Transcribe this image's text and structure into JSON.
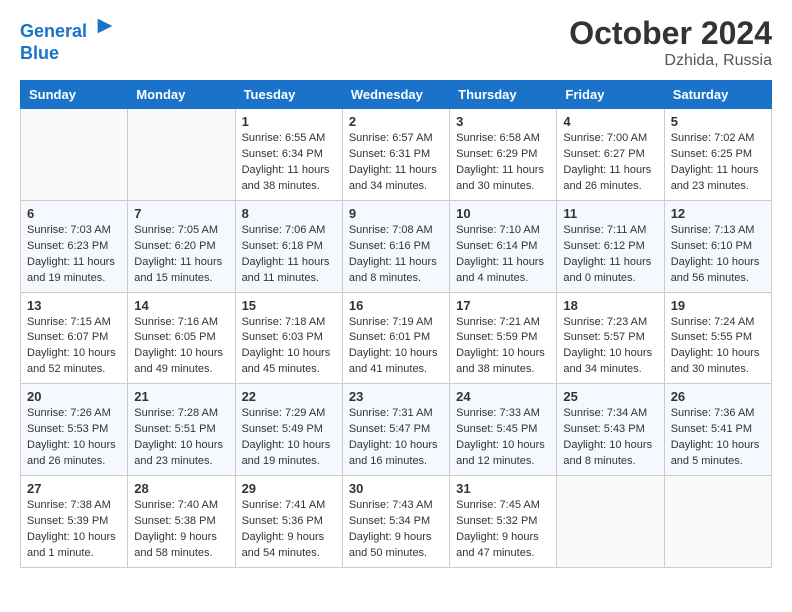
{
  "header": {
    "logo_line1": "General",
    "logo_line2": "Blue",
    "month_year": "October 2024",
    "location": "Dzhida, Russia"
  },
  "days_of_week": [
    "Sunday",
    "Monday",
    "Tuesday",
    "Wednesday",
    "Thursday",
    "Friday",
    "Saturday"
  ],
  "weeks": [
    [
      {
        "num": "",
        "info": ""
      },
      {
        "num": "",
        "info": ""
      },
      {
        "num": "1",
        "info": "Sunrise: 6:55 AM\nSunset: 6:34 PM\nDaylight: 11 hours\nand 38 minutes."
      },
      {
        "num": "2",
        "info": "Sunrise: 6:57 AM\nSunset: 6:31 PM\nDaylight: 11 hours\nand 34 minutes."
      },
      {
        "num": "3",
        "info": "Sunrise: 6:58 AM\nSunset: 6:29 PM\nDaylight: 11 hours\nand 30 minutes."
      },
      {
        "num": "4",
        "info": "Sunrise: 7:00 AM\nSunset: 6:27 PM\nDaylight: 11 hours\nand 26 minutes."
      },
      {
        "num": "5",
        "info": "Sunrise: 7:02 AM\nSunset: 6:25 PM\nDaylight: 11 hours\nand 23 minutes."
      }
    ],
    [
      {
        "num": "6",
        "info": "Sunrise: 7:03 AM\nSunset: 6:23 PM\nDaylight: 11 hours\nand 19 minutes."
      },
      {
        "num": "7",
        "info": "Sunrise: 7:05 AM\nSunset: 6:20 PM\nDaylight: 11 hours\nand 15 minutes."
      },
      {
        "num": "8",
        "info": "Sunrise: 7:06 AM\nSunset: 6:18 PM\nDaylight: 11 hours\nand 11 minutes."
      },
      {
        "num": "9",
        "info": "Sunrise: 7:08 AM\nSunset: 6:16 PM\nDaylight: 11 hours\nand 8 minutes."
      },
      {
        "num": "10",
        "info": "Sunrise: 7:10 AM\nSunset: 6:14 PM\nDaylight: 11 hours\nand 4 minutes."
      },
      {
        "num": "11",
        "info": "Sunrise: 7:11 AM\nSunset: 6:12 PM\nDaylight: 11 hours\nand 0 minutes."
      },
      {
        "num": "12",
        "info": "Sunrise: 7:13 AM\nSunset: 6:10 PM\nDaylight: 10 hours\nand 56 minutes."
      }
    ],
    [
      {
        "num": "13",
        "info": "Sunrise: 7:15 AM\nSunset: 6:07 PM\nDaylight: 10 hours\nand 52 minutes."
      },
      {
        "num": "14",
        "info": "Sunrise: 7:16 AM\nSunset: 6:05 PM\nDaylight: 10 hours\nand 49 minutes."
      },
      {
        "num": "15",
        "info": "Sunrise: 7:18 AM\nSunset: 6:03 PM\nDaylight: 10 hours\nand 45 minutes."
      },
      {
        "num": "16",
        "info": "Sunrise: 7:19 AM\nSunset: 6:01 PM\nDaylight: 10 hours\nand 41 minutes."
      },
      {
        "num": "17",
        "info": "Sunrise: 7:21 AM\nSunset: 5:59 PM\nDaylight: 10 hours\nand 38 minutes."
      },
      {
        "num": "18",
        "info": "Sunrise: 7:23 AM\nSunset: 5:57 PM\nDaylight: 10 hours\nand 34 minutes."
      },
      {
        "num": "19",
        "info": "Sunrise: 7:24 AM\nSunset: 5:55 PM\nDaylight: 10 hours\nand 30 minutes."
      }
    ],
    [
      {
        "num": "20",
        "info": "Sunrise: 7:26 AM\nSunset: 5:53 PM\nDaylight: 10 hours\nand 26 minutes."
      },
      {
        "num": "21",
        "info": "Sunrise: 7:28 AM\nSunset: 5:51 PM\nDaylight: 10 hours\nand 23 minutes."
      },
      {
        "num": "22",
        "info": "Sunrise: 7:29 AM\nSunset: 5:49 PM\nDaylight: 10 hours\nand 19 minutes."
      },
      {
        "num": "23",
        "info": "Sunrise: 7:31 AM\nSunset: 5:47 PM\nDaylight: 10 hours\nand 16 minutes."
      },
      {
        "num": "24",
        "info": "Sunrise: 7:33 AM\nSunset: 5:45 PM\nDaylight: 10 hours\nand 12 minutes."
      },
      {
        "num": "25",
        "info": "Sunrise: 7:34 AM\nSunset: 5:43 PM\nDaylight: 10 hours\nand 8 minutes."
      },
      {
        "num": "26",
        "info": "Sunrise: 7:36 AM\nSunset: 5:41 PM\nDaylight: 10 hours\nand 5 minutes."
      }
    ],
    [
      {
        "num": "27",
        "info": "Sunrise: 7:38 AM\nSunset: 5:39 PM\nDaylight: 10 hours\nand 1 minute."
      },
      {
        "num": "28",
        "info": "Sunrise: 7:40 AM\nSunset: 5:38 PM\nDaylight: 9 hours\nand 58 minutes."
      },
      {
        "num": "29",
        "info": "Sunrise: 7:41 AM\nSunset: 5:36 PM\nDaylight: 9 hours\nand 54 minutes."
      },
      {
        "num": "30",
        "info": "Sunrise: 7:43 AM\nSunset: 5:34 PM\nDaylight: 9 hours\nand 50 minutes."
      },
      {
        "num": "31",
        "info": "Sunrise: 7:45 AM\nSunset: 5:32 PM\nDaylight: 9 hours\nand 47 minutes."
      },
      {
        "num": "",
        "info": ""
      },
      {
        "num": "",
        "info": ""
      }
    ]
  ]
}
